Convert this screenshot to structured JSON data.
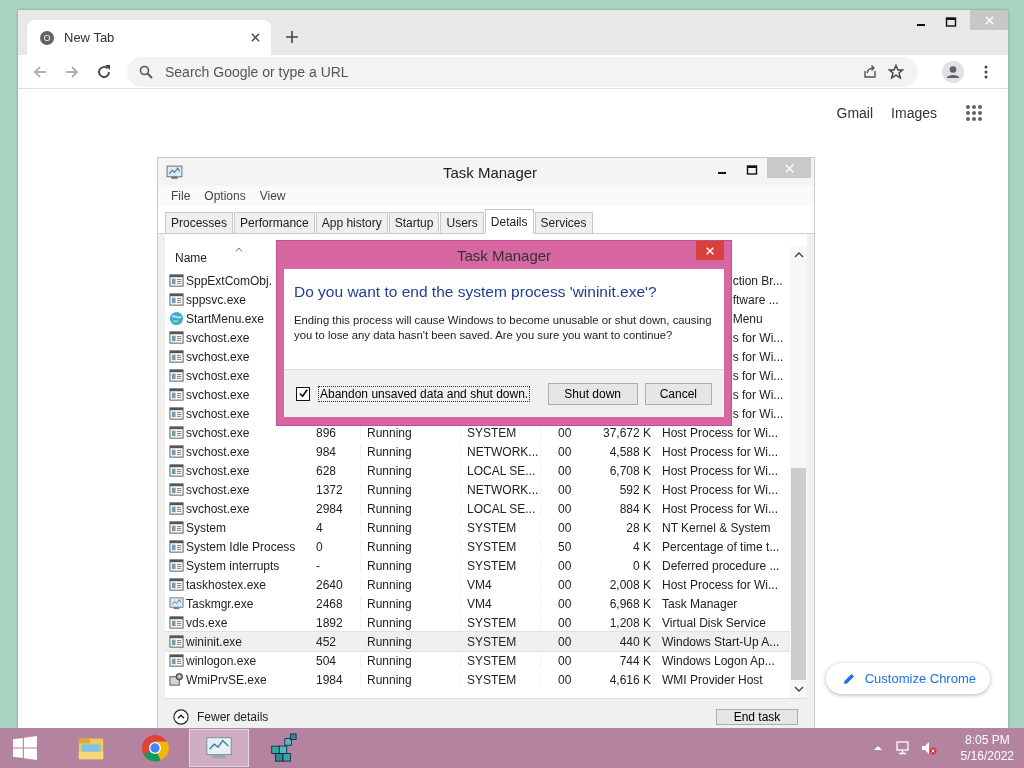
{
  "browser": {
    "tab": {
      "title": "New Tab"
    },
    "omnibox": {
      "placeholder": "Search Google or type a URL"
    },
    "header_links": [
      "Gmail",
      "Images"
    ],
    "customize_button": "Customize Chrome"
  },
  "task_manager": {
    "title": "Task Manager",
    "menu": [
      "File",
      "Options",
      "View"
    ],
    "tabs": [
      {
        "label": "Processes",
        "selected": false
      },
      {
        "label": "Performance",
        "selected": false
      },
      {
        "label": "App history",
        "selected": false
      },
      {
        "label": "Startup",
        "selected": false
      },
      {
        "label": "Users",
        "selected": false
      },
      {
        "label": "Details",
        "selected": true
      },
      {
        "label": "Services",
        "selected": false
      }
    ],
    "columns": [
      {
        "label": "Name"
      }
    ],
    "rows": [
      {
        "name": "SppExtComObj.",
        "description": "ction Br...",
        "kind": "app",
        "selected": false
      },
      {
        "name": "sppsvc.exe",
        "description": "ftware ...",
        "kind": "app",
        "selected": false
      },
      {
        "name": "StartMenu.exe",
        "description": "Menu",
        "kind": "globe",
        "selected": false
      },
      {
        "name": "svchost.exe",
        "description": "s for Wi...",
        "kind": "app",
        "selected": false
      },
      {
        "name": "svchost.exe",
        "description": "s for Wi...",
        "kind": "app",
        "selected": false
      },
      {
        "name": "svchost.exe",
        "description": "s for Wi...",
        "kind": "app",
        "selected": false
      },
      {
        "name": "svchost.exe",
        "description": "s for Wi...",
        "kind": "app",
        "selected": false
      },
      {
        "name": "svchost.exe",
        "description": "s for Wi...",
        "kind": "app",
        "selected": false
      },
      {
        "name": "svchost.exe",
        "pid": "896",
        "status": "Running",
        "user": "SYSTEM",
        "cpu": "00",
        "memory": "37,672 K",
        "description": "Host Process for Wi...",
        "kind": "app",
        "selected": false
      },
      {
        "name": "svchost.exe",
        "pid": "984",
        "status": "Running",
        "user": "NETWORK...",
        "cpu": "00",
        "memory": "4,588 K",
        "description": "Host Process for Wi...",
        "kind": "app",
        "selected": false
      },
      {
        "name": "svchost.exe",
        "pid": "628",
        "status": "Running",
        "user": "LOCAL SE...",
        "cpu": "00",
        "memory": "6,708 K",
        "description": "Host Process for Wi...",
        "kind": "app",
        "selected": false
      },
      {
        "name": "svchost.exe",
        "pid": "1372",
        "status": "Running",
        "user": "NETWORK...",
        "cpu": "00",
        "memory": "592 K",
        "description": "Host Process for Wi...",
        "kind": "app",
        "selected": false
      },
      {
        "name": "svchost.exe",
        "pid": "2984",
        "status": "Running",
        "user": "LOCAL SE...",
        "cpu": "00",
        "memory": "884 K",
        "description": "Host Process for Wi...",
        "kind": "app",
        "selected": false
      },
      {
        "name": "System",
        "pid": "4",
        "status": "Running",
        "user": "SYSTEM",
        "cpu": "00",
        "memory": "28 K",
        "description": "NT Kernel & System",
        "kind": "app",
        "selected": false
      },
      {
        "name": "System Idle Process",
        "pid": "0",
        "status": "Running",
        "user": "SYSTEM",
        "cpu": "50",
        "memory": "4 K",
        "description": "Percentage of time t...",
        "kind": "app",
        "selected": false
      },
      {
        "name": "System interrupts",
        "pid": "-",
        "status": "Running",
        "user": "SYSTEM",
        "cpu": "00",
        "memory": "0 K",
        "description": "Deferred procedure ...",
        "kind": "app",
        "selected": false
      },
      {
        "name": "taskhostex.exe",
        "pid": "2640",
        "status": "Running",
        "user": "VM4",
        "cpu": "00",
        "memory": "2,008 K",
        "description": "Host Process for Wi...",
        "kind": "app",
        "selected": false
      },
      {
        "name": "Taskmgr.exe",
        "pid": "2468",
        "status": "Running",
        "user": "VM4",
        "cpu": "00",
        "memory": "6,968 K",
        "description": "Task Manager",
        "kind": "monitor",
        "selected": false
      },
      {
        "name": "vds.exe",
        "pid": "1892",
        "status": "Running",
        "user": "SYSTEM",
        "cpu": "00",
        "memory": "1,208 K",
        "description": "Virtual Disk Service",
        "kind": "app",
        "selected": false
      },
      {
        "name": "wininit.exe",
        "pid": "452",
        "status": "Running",
        "user": "SYSTEM",
        "cpu": "00",
        "memory": "440 K",
        "description": "Windows Start-Up A...",
        "kind": "app",
        "selected": true
      },
      {
        "name": "winlogon.exe",
        "pid": "504",
        "status": "Running",
        "user": "SYSTEM",
        "cpu": "00",
        "memory": "744 K",
        "description": "Windows Logon Ap...",
        "kind": "app",
        "selected": false
      },
      {
        "name": "WmiPrvSE.exe",
        "pid": "1984",
        "status": "Running",
        "user": "SYSTEM",
        "cpu": "00",
        "memory": "4,616 K",
        "description": "WMI Provider Host",
        "kind": "gears",
        "selected": false
      }
    ],
    "footer": {
      "toggle": "Fewer details",
      "end_task": "End task"
    }
  },
  "dialog": {
    "title": "Task Manager",
    "heading": "Do you want to end the system process 'wininit.exe'?",
    "message": "Ending this process will cause Windows to become unusable or shut down, causing you to lose any data hasn't been saved. Are you sure you want to continue?",
    "checkbox": {
      "label": "Abandon unsaved data and shut down.",
      "checked": true
    },
    "buttons": [
      "Shut down",
      "Cancel"
    ]
  },
  "taskbar": {
    "clock": {
      "time": "8:05 PM",
      "date": "5/16/2022"
    }
  }
}
